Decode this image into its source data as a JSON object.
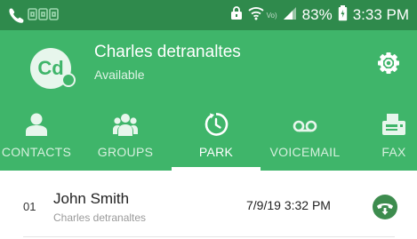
{
  "status_bar": {
    "signal_text": "Vo)",
    "battery_percent": "83%",
    "time": "3:33 PM"
  },
  "header": {
    "avatar_initials": "Cd",
    "user_name": "Charles detranaltes",
    "user_status": "Available",
    "presence_color": "#3fb56a"
  },
  "tabs": [
    {
      "label": "CONTACTS",
      "icon": "person-icon",
      "active": false
    },
    {
      "label": "GROUPS",
      "icon": "group-icon",
      "active": false
    },
    {
      "label": "PARK",
      "icon": "park-icon",
      "active": true
    },
    {
      "label": "VOICEMAIL",
      "icon": "voicemail-icon",
      "active": false
    },
    {
      "label": "FAX",
      "icon": "fax-icon",
      "active": false
    }
  ],
  "parked_calls": [
    {
      "slot": "01",
      "caller_name": "John Smith",
      "parked_by": "Charles detranaltes",
      "time": "7/9/19 3:32 PM"
    }
  ],
  "colors": {
    "status_bar": "#2f8a4c",
    "header": "#3fb56a",
    "accent_button": "#3d8c4e"
  }
}
